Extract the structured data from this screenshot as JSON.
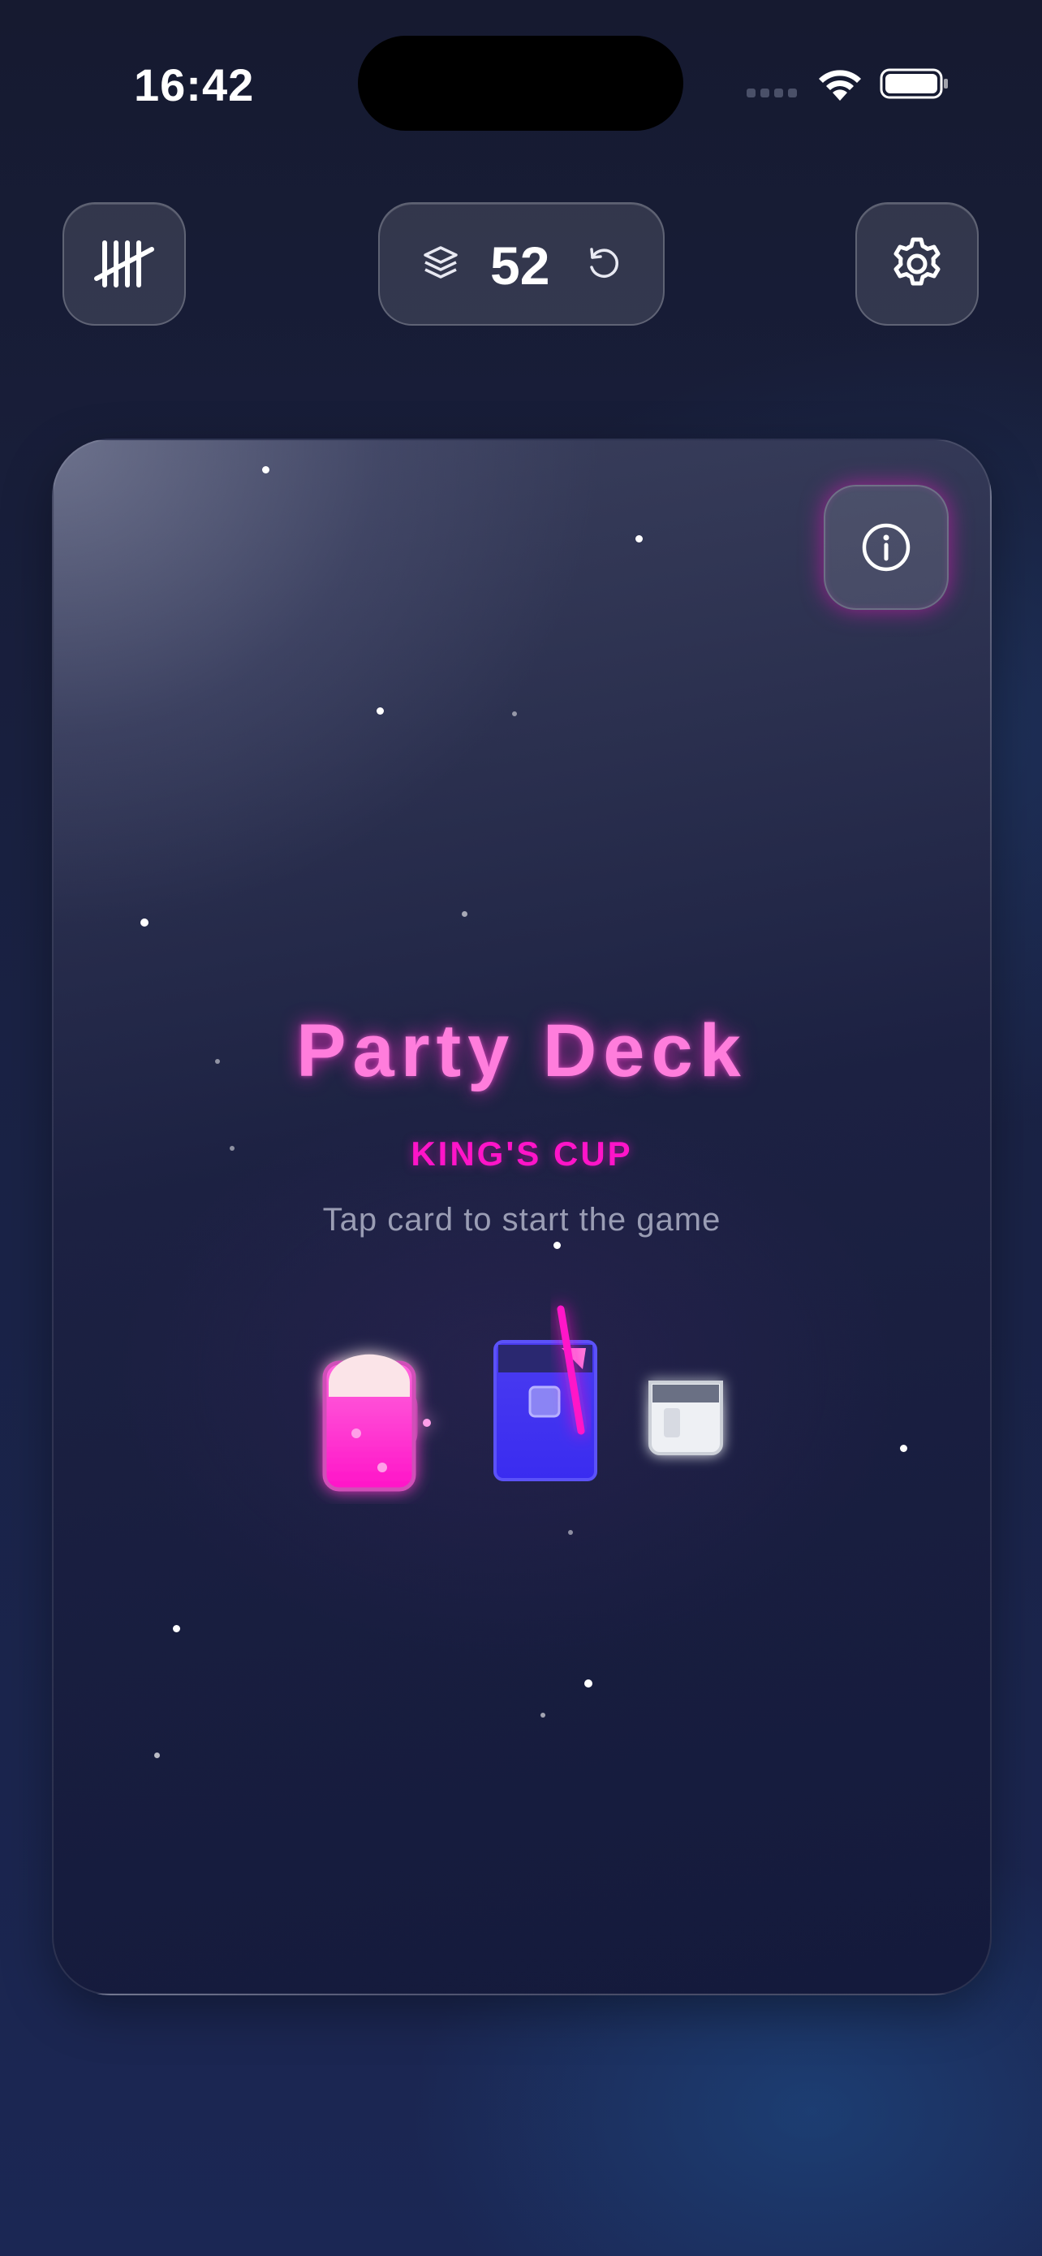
{
  "status_bar": {
    "time": "16:42"
  },
  "header": {
    "deck_count": "52"
  },
  "card": {
    "title": "Party Deck",
    "subtitle": "KING'S CUP",
    "hint": "Tap card to start the game"
  },
  "icons": {
    "tally": "tally-marks-icon",
    "deck": "layers-icon",
    "reset": "rotate-ccw-icon",
    "settings": "gear-icon",
    "info": "info-circle-icon"
  },
  "colors": {
    "accent_pink": "#ff14c8",
    "title_pink": "#ff7ddc",
    "cocktail_blue": "#3a2cf0"
  }
}
